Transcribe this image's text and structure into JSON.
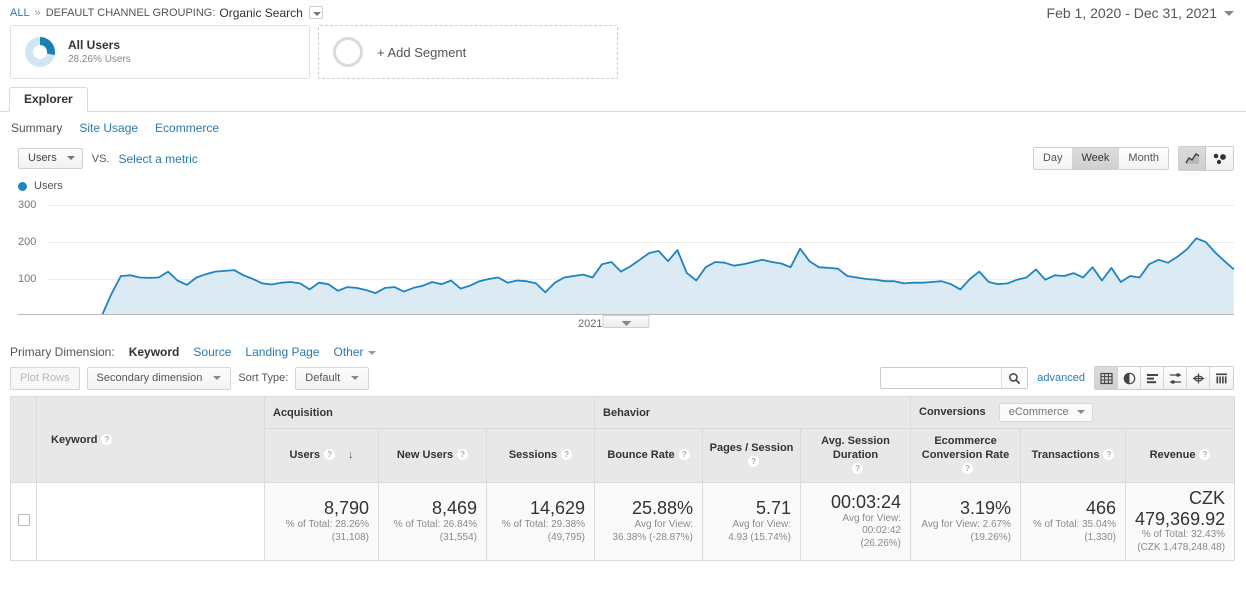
{
  "breadcrumb": {
    "all": "ALL",
    "separator": "»",
    "dimension_label": "DEFAULT CHANNEL GROUPING:",
    "dimension_value": "Organic Search"
  },
  "date_range": "Feb 1, 2020 - Dec 31, 2021",
  "segments": {
    "all_users": {
      "title": "All Users",
      "subtitle": "28.26% Users"
    },
    "add_segment": "+ Add Segment"
  },
  "tabs": {
    "explorer": "Explorer"
  },
  "subtabs": [
    {
      "label": "Summary",
      "active": true
    },
    {
      "label": "Site Usage",
      "active": false
    },
    {
      "label": "Ecommerce",
      "active": false
    }
  ],
  "metric_row": {
    "metric": "Users",
    "vs": "VS.",
    "select_metric": "Select a metric",
    "granularity": [
      {
        "label": "Day",
        "active": false
      },
      {
        "label": "Week",
        "active": true
      },
      {
        "label": "Month",
        "active": false
      }
    ]
  },
  "chart_data": {
    "type": "area",
    "title": "",
    "legend": "Users",
    "legend_color": "#1f83c4",
    "xlabel": "",
    "ylabel": "",
    "x_tick_labels": [
      "2021"
    ],
    "y_tick_labels": [
      "100",
      "200",
      "300"
    ],
    "ylim": [
      0,
      340
    ],
    "grid": true,
    "series": [
      {
        "name": "Users",
        "color": "#1f83c4",
        "fill": "#dceaf4",
        "values": [
          2,
          2,
          2,
          2,
          2,
          2,
          2,
          2,
          60,
          108,
          110,
          104,
          103,
          104,
          120,
          96,
          84,
          104,
          113,
          120,
          122,
          124,
          110,
          100,
          88,
          85,
          90,
          92,
          88,
          72,
          90,
          86,
          68,
          78,
          76,
          70,
          62,
          76,
          78,
          66,
          76,
          82,
          92,
          86,
          96,
          74,
          82,
          94,
          100,
          104,
          90,
          96,
          94,
          88,
          64,
          90,
          104,
          108,
          112,
          104,
          140,
          146,
          120,
          134,
          152,
          170,
          176,
          148,
          178,
          116,
          96,
          132,
          146,
          144,
          136,
          140,
          146,
          152,
          146,
          142,
          132,
          182,
          148,
          132,
          130,
          128,
          108,
          104,
          100,
          98,
          94,
          94,
          88,
          90,
          90,
          92,
          94,
          86,
          72,
          100,
          120,
          92,
          86,
          88,
          98,
          104,
          126,
          98,
          110,
          108,
          116,
          104,
          132,
          96,
          130,
          92,
          108,
          104,
          140,
          152,
          144,
          160,
          180,
          210,
          200,
          172,
          148,
          126
        ]
      }
    ]
  },
  "primary_dimension": {
    "label": "Primary Dimension:",
    "active": "Keyword",
    "links": [
      "Source",
      "Landing Page"
    ],
    "other": "Other"
  },
  "table_toolbar": {
    "plot_rows": "Plot Rows",
    "secondary_dimension": "Secondary dimension",
    "sort_type_label": "Sort Type:",
    "sort_type_value": "Default",
    "search_value": "",
    "search_placeholder": "",
    "advanced": "advanced"
  },
  "table": {
    "groups": [
      {
        "name": "Acquisition",
        "span": 3
      },
      {
        "name": "Behavior",
        "span": 3
      },
      {
        "name": "Conversions",
        "span": 3,
        "selector": "eCommerce"
      }
    ],
    "dimension_header": "Keyword",
    "columns": [
      {
        "label": "Users",
        "sorted": true
      },
      {
        "label": "New Users",
        "sorted": false
      },
      {
        "label": "Sessions",
        "sorted": false
      },
      {
        "label": "Bounce Rate",
        "sorted": false
      },
      {
        "label": "Pages / Session",
        "sorted": false
      },
      {
        "label": "Avg. Session Duration",
        "sorted": false
      },
      {
        "label": "Ecommerce Conversion Rate",
        "sorted": false
      },
      {
        "label": "Transactions",
        "sorted": false
      },
      {
        "label": "Revenue",
        "sorted": false
      }
    ],
    "summary_row": [
      {
        "value": "8,790",
        "line1": "% of Total: 28.26%",
        "line2": "(31,108)"
      },
      {
        "value": "8,469",
        "line1": "% of Total: 26.84%",
        "line2": "(31,554)"
      },
      {
        "value": "14,629",
        "line1": "% of Total: 29.38%",
        "line2": "(49,795)"
      },
      {
        "value": "25.88%",
        "line1": "Avg for View:",
        "line2": "36.38% (-28.87%)"
      },
      {
        "value": "5.71",
        "line1": "Avg for View:",
        "line2": "4.93 (15.74%)"
      },
      {
        "value": "00:03:24",
        "line1": "Avg for View: 00:02:42",
        "line2": "(26.26%)"
      },
      {
        "value": "3.19%",
        "line1": "Avg for View: 2.67%",
        "line2": "(19.26%)"
      },
      {
        "value": "466",
        "line1": "% of Total: 35.04%",
        "line2": "(1,330)"
      },
      {
        "value": "CZK 479,369.92",
        "line1": "% of Total: 32.43%",
        "line2": "(CZK 1,478,248.48)"
      }
    ]
  },
  "colors": {
    "link": "#2a7ab0",
    "chart_line": "#1f83c4",
    "chart_fill": "#dceaf4",
    "header_bg": "#e8e8e8"
  }
}
